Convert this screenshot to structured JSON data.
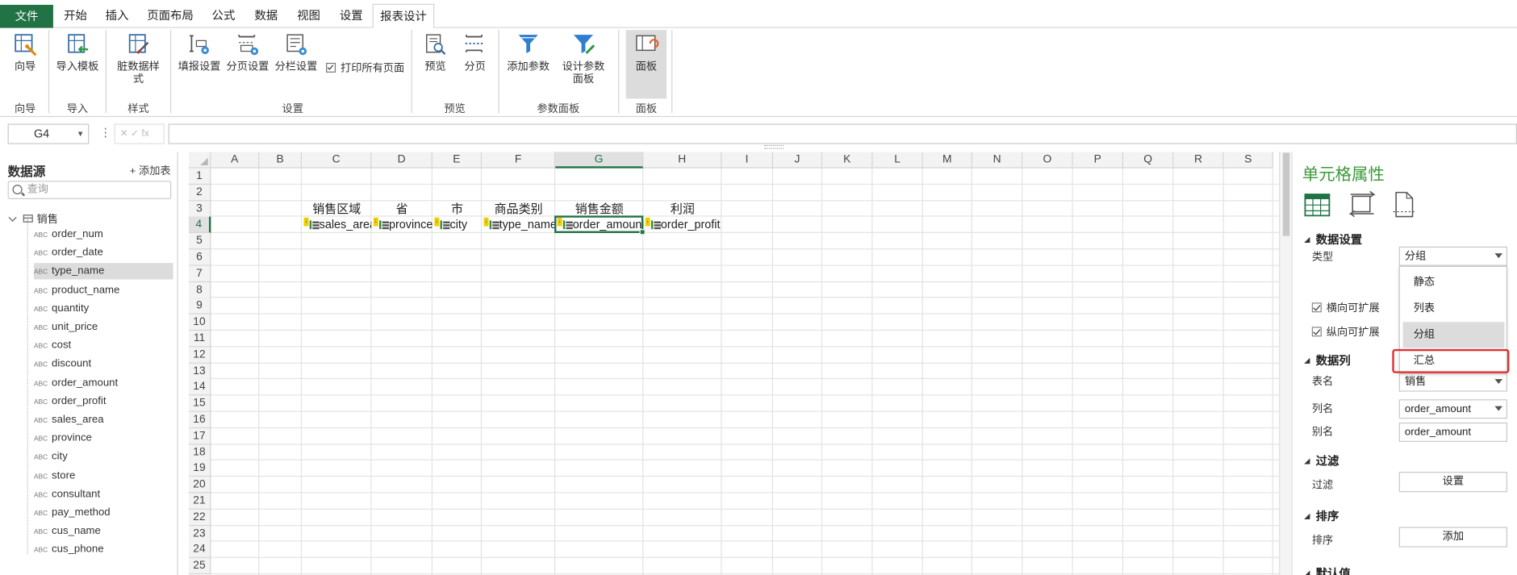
{
  "menu": {
    "file": "文件",
    "tabs": [
      "开始",
      "插入",
      "页面布局",
      "公式",
      "数据",
      "视图",
      "设置",
      "报表设计"
    ],
    "active_tab": "报表设计"
  },
  "ribbon": {
    "buttons": {
      "wizard": "向导",
      "import_template": "导入模板",
      "dirty_style": "脏数据样式",
      "fill_settings": "填报设置",
      "page_settings": "分页设置",
      "column_settings": "分栏设置",
      "print_all": "打印所有页面",
      "preview": "预览",
      "paging": "分页",
      "add_param": "添加参数",
      "design_param_panel": "设计参数面板",
      "panel": "面板"
    },
    "groups": {
      "wizard": "向导",
      "import": "导入",
      "style": "样式",
      "settings": "设置",
      "preview": "预览",
      "param_panel": "参数面板",
      "panel": "面板"
    }
  },
  "formula_bar": {
    "cell_ref": "G4",
    "icons": "✕ ✓ fx",
    "value": ""
  },
  "datasource": {
    "title": "数据源",
    "add_table": "+ 添加表",
    "search_placeholder": "查询",
    "table_name": "销售",
    "field_tag": "ABC",
    "selected_field": "type_name",
    "fields": [
      "order_num",
      "order_date",
      "type_name",
      "product_name",
      "quantity",
      "unit_price",
      "cost",
      "discount",
      "order_amount",
      "order_profit",
      "sales_area",
      "province",
      "city",
      "store",
      "consultant",
      "pay_method",
      "cus_name",
      "cus_phone"
    ]
  },
  "sheet": {
    "columns": [
      "A",
      "B",
      "C",
      "D",
      "E",
      "F",
      "G",
      "H",
      "I",
      "J",
      "K",
      "L",
      "M",
      "N",
      "O",
      "P",
      "Q",
      "R",
      "S"
    ],
    "active_column": "G",
    "rows": [
      "1",
      "2",
      "3",
      "4",
      "5",
      "6",
      "7",
      "8",
      "9",
      "10",
      "11",
      "12",
      "13",
      "14",
      "15",
      "16",
      "17",
      "18",
      "19",
      "20",
      "21",
      "22",
      "23",
      "24",
      "25"
    ],
    "active_row": "4",
    "headers": {
      "C": "销售区域",
      "D": "省",
      "E": "市",
      "F": "商品类别",
      "G": "销售金额",
      "H": "利润"
    },
    "fields": {
      "C": "sales_area",
      "D": "province",
      "E": "city",
      "F": "type_name",
      "G": "order_amount",
      "H": "order_profit"
    }
  },
  "props": {
    "title": "单元格属性",
    "data_settings": "数据设置",
    "type_label": "类型",
    "type_value": "分组",
    "type_options": [
      "静态",
      "列表",
      "分组",
      "汇总"
    ],
    "horizontal_expand": "横向可扩展",
    "vertical_expand": "纵向可扩展",
    "data_column": "数据列",
    "table_label": "表名",
    "table_value": "销售",
    "col_label": "列名",
    "col_value": "order_amount",
    "alias_label": "别名",
    "alias_value": "order_amount",
    "filter_section": "过滤",
    "filter_label": "过滤",
    "filter_button": "设置",
    "sort_section": "排序",
    "sort_label": "排序",
    "sort_button": "添加",
    "default_section": "默认值"
  },
  "colors": {
    "accent_green": "#217346",
    "title_green": "#3a9a3a",
    "highlight_red": "#e03030"
  }
}
